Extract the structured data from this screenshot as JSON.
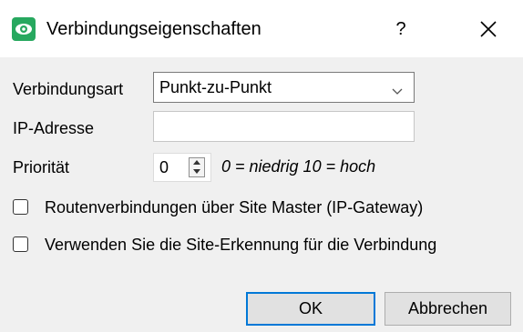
{
  "window": {
    "title": "Verbindungseigenschaften",
    "help_label": "?",
    "icon": "eye-app-icon",
    "close_icon": "close-icon"
  },
  "form": {
    "connection_type": {
      "label": "Verbindungsart",
      "value": "Punkt-zu-Punkt"
    },
    "ip_address": {
      "label": "IP-Adresse",
      "value": ""
    },
    "priority": {
      "label": "Priorität",
      "value": "0",
      "hint": "0 = niedrig 10 = hoch"
    },
    "checkboxes": [
      {
        "label": "Routenverbindungen über Site Master (IP-Gateway)",
        "checked": false
      },
      {
        "label": "Verwenden Sie die Site-Erkennung für die Verbindung",
        "checked": false
      }
    ]
  },
  "buttons": {
    "ok_label": "OK",
    "cancel_label": "Abbrechen"
  },
  "colors": {
    "accent": "#0078d7",
    "icon_green": "#27a85f",
    "dialog_bg": "#f0f0f0"
  }
}
